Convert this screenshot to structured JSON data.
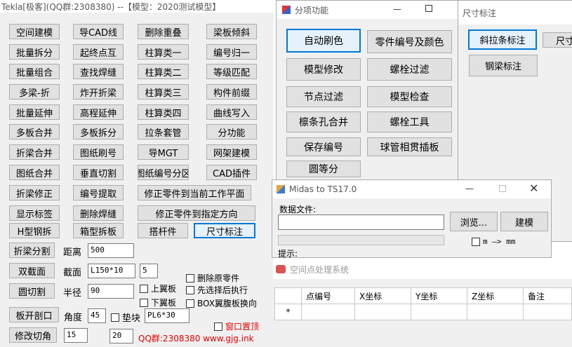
{
  "main": {
    "title": "Tekla[极客](QQ群:2308380) --【模型：2020测试模型】",
    "buttons": [
      "空间建模",
      "导CAD线",
      "删除重叠",
      "梁板倾斜",
      "批量拆分",
      "起终点互",
      "柱算类一",
      "编号归一",
      "批量组合",
      "查找焊缝",
      "柱算类二",
      "等级匹配",
      "多梁-折",
      "炸开折梁",
      "柱算类三",
      "构件前缀",
      "批量延伸",
      "高程延伸",
      "柱算类四",
      "曲线写入",
      "多板合并",
      "多板拆分",
      "拉条套管",
      "分功能",
      "折梁合并",
      "图纸刷号",
      "导MGT",
      "网架建模",
      "图纸合并",
      "垂直切割",
      "图纸编号分区",
      "CAD插件",
      "折梁修正",
      "编号提取",
      "修正零件到当前工作平面",
      "显示标签",
      "删除焊缝",
      "修正零件到指定方向",
      "H型钢拆",
      "箱型拆板",
      "搭杆件",
      "尺寸标注"
    ],
    "split_button": "折梁分割",
    "distance_label": "距离",
    "distance_value": "500",
    "double_section_button": "双截面",
    "section_label": "截面",
    "section_value": "L150*10",
    "section_count": "5",
    "round_cut_button": "圆切割",
    "radius_label": "半径",
    "radius_value": "90",
    "slot_button": "板开剖口",
    "angle_label": "角度",
    "angle_value": "45",
    "pad_label": "垫块",
    "pad_value": "PL6*30",
    "chamfer_button": "修改切角",
    "chamfer_a": "15",
    "chamfer_b": "20",
    "chk_delete_original": "删除原零件",
    "chk_upper_flange": "上翼板",
    "chk_select_then": "先选择后执行",
    "chk_lower_flange": "下翼板",
    "chk_box_web": "BOX翼腹板换向",
    "chk_window_top": "窗口置顶",
    "footer": "QQ群:2308380 www.gjg.ink"
  },
  "sub_window": {
    "title": "分项功能",
    "buttons": [
      "自动刷色",
      "零件编号及颜色",
      "模型修改",
      "螺栓过滤",
      "节点过滤",
      "模型检查",
      "檩条孔合并",
      "螺栓工具",
      "保存编号",
      "球管相贯插板",
      "圆等分"
    ]
  },
  "dim_window": {
    "title": "尺寸标注",
    "buttons": [
      "斜拉条标注",
      "尺寸",
      "钢梁标注"
    ]
  },
  "midas_window": {
    "title": "Midas to TS17.0",
    "data_file_label": "数据文件:",
    "file_value": "",
    "browse_button": "浏览...",
    "build_button": "建模",
    "unit_check_label": "m —> mm",
    "prompt_label": "提示:"
  },
  "space_window": {
    "title": "空间点处理系统",
    "columns": [
      "点编号",
      "X坐标",
      "Y坐标",
      "Z坐标",
      "备注"
    ],
    "new_row_marker": "*"
  },
  "colors": {
    "accent": "#0078d7",
    "footer_red": "#e00000"
  }
}
